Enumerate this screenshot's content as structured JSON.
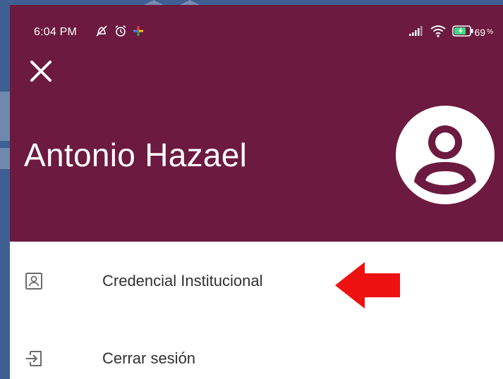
{
  "status_bar": {
    "time": "6:04 PM",
    "battery_percent": "69",
    "battery_suffix": "%",
    "icons": [
      "notifications-off-icon",
      "alarm-icon",
      "app-notification-icon",
      "signal-icon",
      "wifi-icon",
      "battery-charging-icon"
    ]
  },
  "header": {
    "close_icon": "close-icon",
    "user_name": "Antonio Hazael",
    "avatar_icon": "account-circle-icon",
    "background_color": "#6c1a40"
  },
  "menu": {
    "items": [
      {
        "label": "Credencial Institucional",
        "icon": "id-card-icon"
      },
      {
        "label": "Cerrar sesión",
        "icon": "logout-icon"
      }
    ]
  },
  "annotation": {
    "arrow_color": "#ee1111",
    "arrow_icon": "red-arrow-left-icon"
  },
  "frame": {
    "background_color": "#3f5f92"
  }
}
